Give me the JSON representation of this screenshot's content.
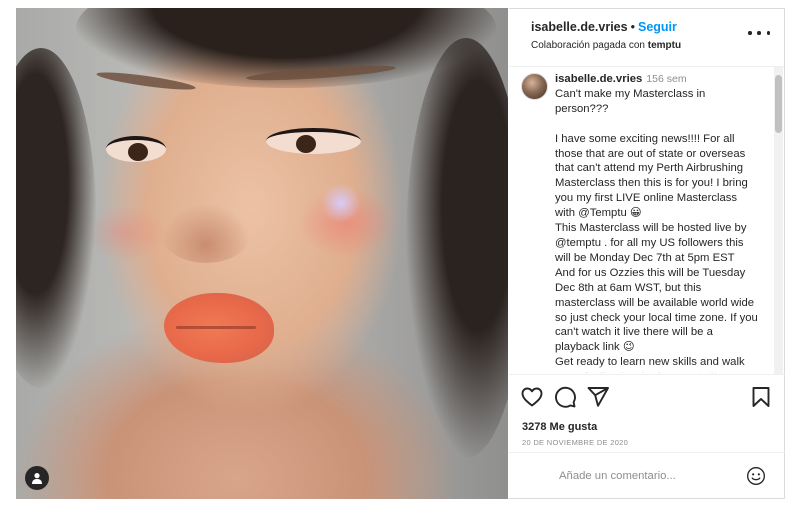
{
  "post": {
    "username": "isabelle.de.vries",
    "separator": "•",
    "follow_label": "Seguir",
    "paid_label": "Colaboración pagada con",
    "partner": "temptu",
    "more_icon": "more-horizontal-icon"
  },
  "caption": {
    "username": "isabelle.de.vries",
    "time": "156 sem",
    "text": "Can't make my Masterclass in person???\n\nI have some exciting news!!!! For all those that are out of state or overseas that can't attend my Perth Airbrushing Masterclass then this is for you! I bring you my first LIVE online Masterclass with @Temptu 😀\nThis Masterclass will be hosted live by @temptu . for all my US followers this will be Monday Dec 7th at 5pm EST\nAnd for us Ozzies this will be Tuesday Dec 8th at 6am WST, but this masterclass will be available world wide so just check your local time zone. If you can't watch it live there will be a playback link 😉\nGet ready to learn new skills and walk away feeling inspired to create!!!"
  },
  "actions": {
    "icons": [
      "heart-icon",
      "comment-icon",
      "share-icon",
      "bookmark-icon"
    ],
    "likes": "3278 Me gusta",
    "date": "20 DE NOVIEMBRE DE 2020"
  },
  "comment_box": {
    "placeholder": "Añade un comentario...",
    "emoji_icon": "smiley-icon"
  },
  "colors": {
    "link": "#0095f6",
    "text": "#262626",
    "muted": "#8e8e8e",
    "border": "#dbdbdb"
  }
}
